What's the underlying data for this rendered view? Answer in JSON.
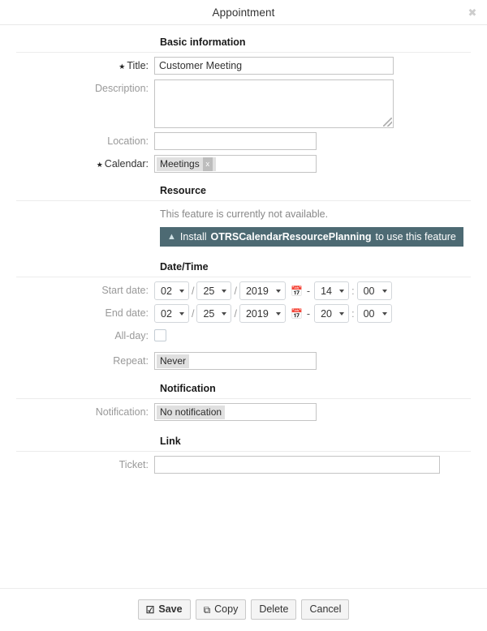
{
  "window": {
    "title": "Appointment",
    "close_label": "✖"
  },
  "sections": {
    "basic": "Basic information",
    "resource": "Resource",
    "datetime": "Date/Time",
    "notification": "Notification",
    "link": "Link"
  },
  "fields": {
    "title": {
      "label": "Title:",
      "value": "Customer Meeting",
      "required": true
    },
    "description": {
      "label": "Description:",
      "value": "",
      "required": false
    },
    "location": {
      "label": "Location:",
      "value": "",
      "required": false
    },
    "calendar": {
      "label": "Calendar:",
      "tag": "Meetings",
      "tag_remove": "x",
      "required": true
    },
    "all_day": {
      "label": "All-day:",
      "checked": false
    },
    "repeat": {
      "label": "Repeat:",
      "value": "Never"
    },
    "notification": {
      "label": "Notification:",
      "value": "No notification"
    },
    "ticket": {
      "label": "Ticket:",
      "value": ""
    }
  },
  "resource": {
    "message": "This feature is currently not available.",
    "install_prefix": "Install",
    "install_package": "OTRSCalendarResourcePlanning",
    "install_suffix": "to use this feature",
    "banner_color": "#4d6a73",
    "chevron": "«"
  },
  "start_date": {
    "label": "Start date:",
    "month": "02",
    "day": "25",
    "year": "2019",
    "hour": "14",
    "minute": "00",
    "date_separator": "/",
    "dash": "-",
    "time_separator": ":",
    "calendar_icon": "📅"
  },
  "end_date": {
    "label": "End date:",
    "month": "02",
    "day": "25",
    "year": "2019",
    "hour": "20",
    "minute": "00",
    "date_separator": "/",
    "dash": "-",
    "time_separator": ":",
    "calendar_icon": "📅"
  },
  "footer": {
    "save": "Save",
    "save_icon": "☑",
    "copy": "Copy",
    "copy_icon": "⧉",
    "delete": "Delete",
    "cancel": "Cancel"
  }
}
